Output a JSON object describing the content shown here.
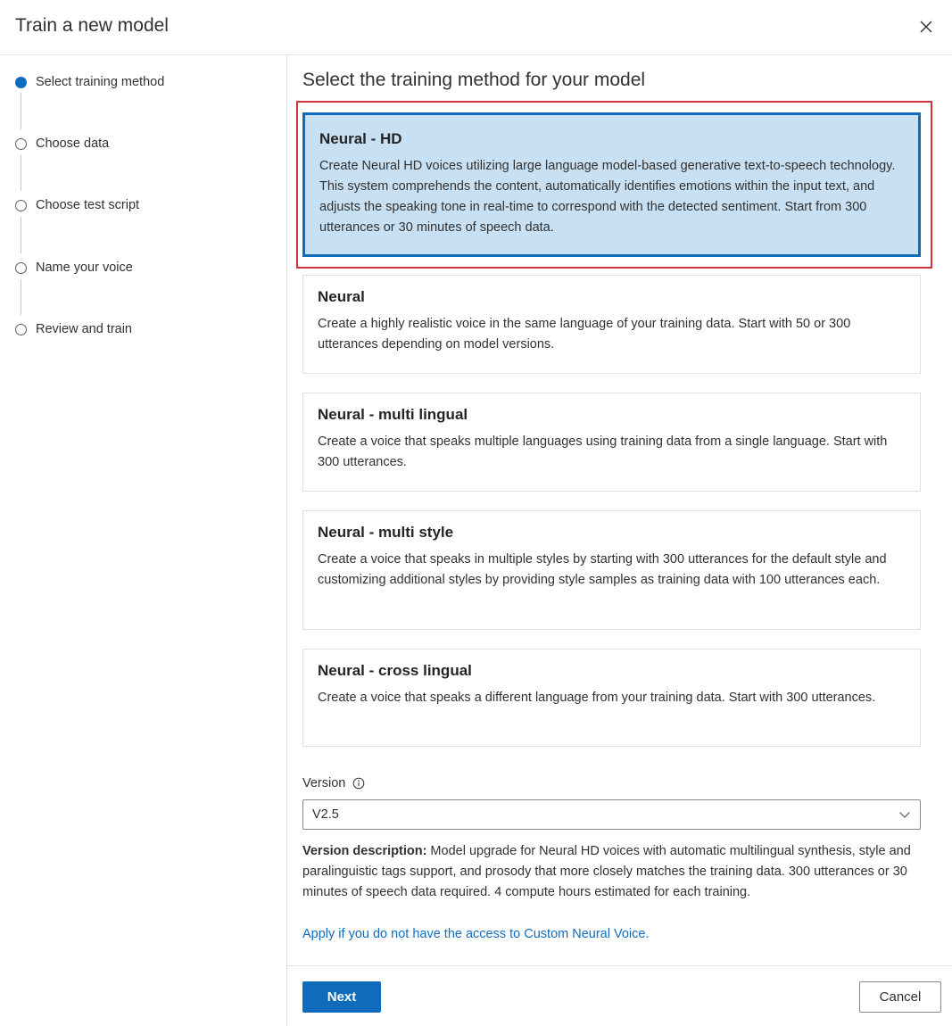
{
  "dialog": {
    "title": "Train a new model",
    "close_icon": "close-icon"
  },
  "steps": [
    {
      "label": "Select training method",
      "state": "active"
    },
    {
      "label": "Choose data",
      "state": "pending"
    },
    {
      "label": "Choose test script",
      "state": "pending"
    },
    {
      "label": "Name your voice",
      "state": "pending"
    },
    {
      "label": "Review and train",
      "state": "pending"
    }
  ],
  "main": {
    "title": "Select the training method for your model",
    "options": [
      {
        "title": "Neural - HD",
        "description": "Create Neural HD voices utilizing large language model-based generative text-to-speech technology. This system comprehends the content, automatically identifies emotions within the input text, and adjusts the speaking tone in real-time to correspond with the detected sentiment. Start from 300 utterances or 30 minutes of speech data.",
        "selected": true
      },
      {
        "title": "Neural",
        "description": "Create a highly realistic voice in the same language of your training data. Start with 50 or 300 utterances depending on model versions.",
        "selected": false
      },
      {
        "title": "Neural - multi lingual",
        "description": "Create a voice that speaks multiple languages using training data from a single language. Start with 300 utterances.",
        "selected": false
      },
      {
        "title": "Neural - multi style",
        "description": "Create a voice that speaks in multiple styles by starting with 300 utterances for the default style and customizing additional styles by providing style samples as training data with 100 utterances each.",
        "selected": false
      },
      {
        "title": "Neural - cross lingual",
        "description": "Create a voice that speaks a different language from your training data. Start with 300 utterances.",
        "selected": false
      }
    ],
    "version": {
      "label": "Version",
      "info_icon": "info-icon",
      "selected_value": "V2.5",
      "dropdown_icon": "chevron-down-icon"
    },
    "version_description": {
      "label": "Version description:",
      "text": " Model upgrade for Neural HD voices with automatic multilingual synthesis, style and paralinguistic tags support, and prosody that more closely matches the training data. 300 utterances or 30 minutes of speech data required. 4 compute hours estimated for each training."
    },
    "apply_link": "Apply if you do not have the access to Custom Neural Voice."
  },
  "footer": {
    "next_label": "Next",
    "cancel_label": "Cancel"
  },
  "colors": {
    "accent": "#0f6cbd",
    "selected_card_bg": "#c7e0f4",
    "highlight_border": "#d13438"
  }
}
